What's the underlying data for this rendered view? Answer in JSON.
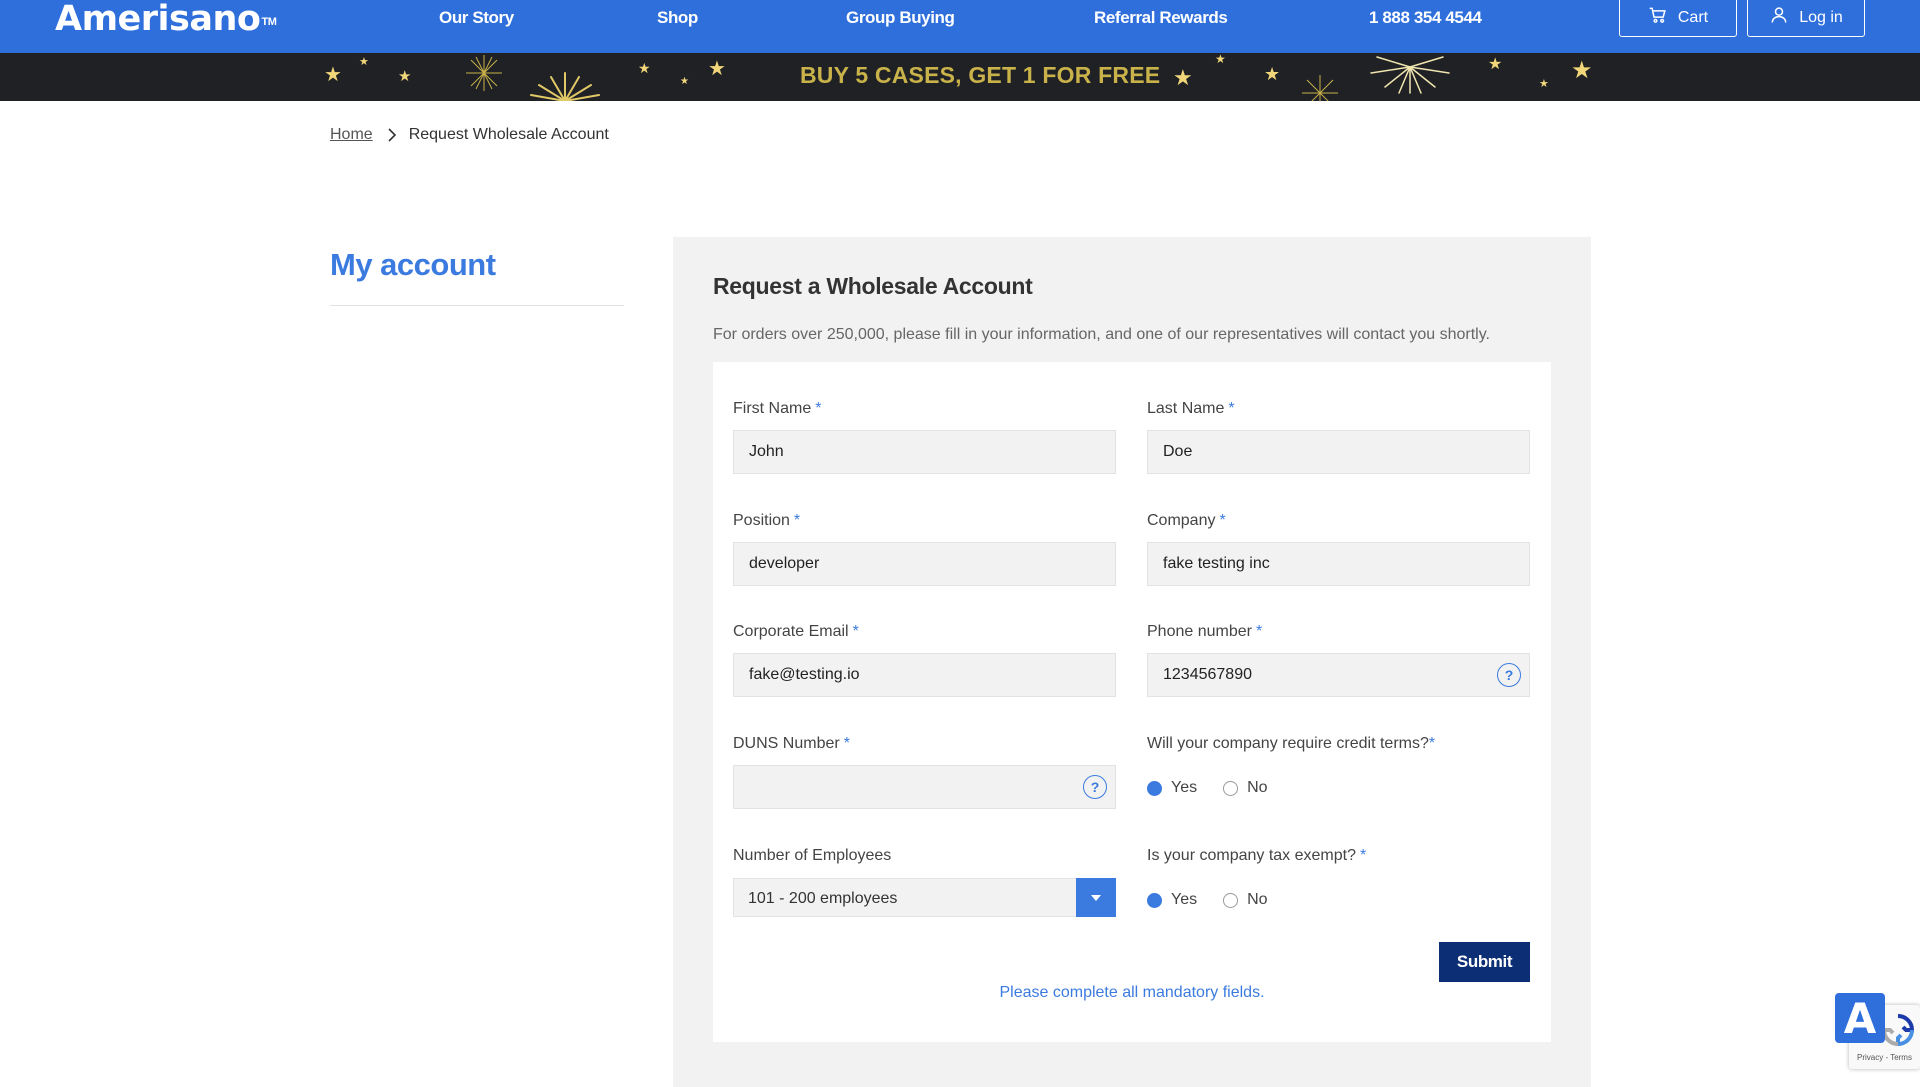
{
  "header": {
    "logo": "Amerisano",
    "logo_tm": "TM",
    "nav": [
      "Our Story",
      "Shop",
      "Group Buying",
      "Referral Rewards"
    ],
    "phone": "1 888 354 4544",
    "cart_label": "Cart",
    "login_label": "Log in"
  },
  "promo": {
    "text": "BUY 5 CASES, GET 1 FOR FREE"
  },
  "breadcrumb": {
    "home": "Home",
    "current": "Request Wholesale Account"
  },
  "sidebar": {
    "title": "My account"
  },
  "form": {
    "title": "Request a Wholesale Account",
    "description": "For orders over 250,000, please fill in your information, and one of our representatives will contact you shortly.",
    "required_mark": "*",
    "first_name": {
      "label": "First Name",
      "value": "John"
    },
    "last_name": {
      "label": "Last Name",
      "value": "Doe"
    },
    "position": {
      "label": "Position",
      "value": "developer"
    },
    "company": {
      "label": "Company",
      "value": "fake testing inc"
    },
    "email": {
      "label": "Corporate Email",
      "value": "fake@testing.io"
    },
    "phone": {
      "label": "Phone number",
      "value": "1234567890"
    },
    "duns": {
      "label": "DUNS Number",
      "value": ""
    },
    "credit_terms": {
      "label": "Will your company require credit terms?",
      "selected": "Yes"
    },
    "employees": {
      "label": "Number of Employees",
      "value": "101 - 200 employees"
    },
    "tax_exempt": {
      "label": "Is your company tax exempt?",
      "selected": "Yes"
    },
    "radio_yes": "Yes",
    "radio_no": "No",
    "help_icon": "?",
    "submit_label": "Submit",
    "notice": "Please complete all mandatory fields."
  },
  "widgets": {
    "accessibility_label": "A",
    "recaptcha_links": "Privacy - Terms"
  },
  "colors": {
    "brand_blue": "#2f6fdc",
    "accent_blue": "#3b7be0",
    "submit_navy": "#0c2e75",
    "promo_gold": "#c9b24a"
  }
}
